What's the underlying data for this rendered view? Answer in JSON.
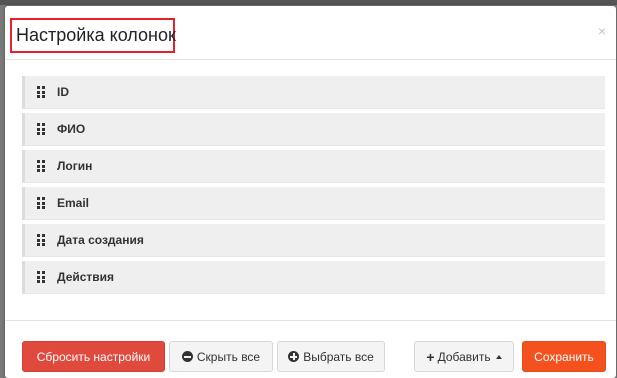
{
  "modal": {
    "title": "Настройка колонок",
    "close_glyph": "×"
  },
  "columns": [
    {
      "label": "ID"
    },
    {
      "label": "ФИО"
    },
    {
      "label": "Логин"
    },
    {
      "label": "Email"
    },
    {
      "label": "Дата создания"
    },
    {
      "label": "Действия"
    }
  ],
  "footer": {
    "reset_label": "Сбросить настройки",
    "hide_all_label": "Скрыть все",
    "select_all_label": "Выбрать все",
    "add_label": "Добавить",
    "save_label": "Сохранить"
  },
  "icons": {
    "drag": "drag-handle-icon",
    "hide_all": "minus-circle-icon",
    "select_all": "plus-circle-icon",
    "add": "plus-icon",
    "dropdown": "caret-up-icon"
  },
  "colors": {
    "title_highlight": "#e8202d",
    "reset_button": "#e04a3d",
    "save_button": "#f4511e",
    "column_item_bg": "#efefef"
  }
}
